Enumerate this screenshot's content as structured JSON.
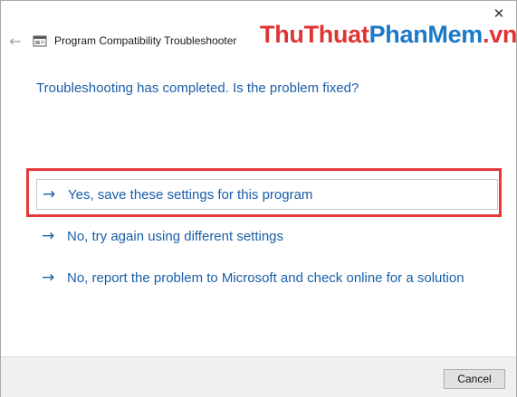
{
  "window": {
    "title": "Program Compatibility Troubleshooter",
    "close_glyph": "✕",
    "back_glyph": "←"
  },
  "watermark": {
    "part1": "ThuThuat",
    "part2": "PhanMem",
    "part3": ".vn"
  },
  "content": {
    "question": "Troubleshooting has completed.  Is the problem fixed?",
    "options": [
      {
        "label": "Yes, save these settings for this program",
        "selected": true
      },
      {
        "label": "No, try again using different settings",
        "selected": false
      },
      {
        "label": "No, report the problem to Microsoft and check online for a solution",
        "selected": false
      }
    ]
  },
  "footer": {
    "cancel_label": "Cancel"
  },
  "colors": {
    "link_blue": "#1a5ea8",
    "highlight_red": "#e53838",
    "footer_bg": "#f0f0f0"
  }
}
